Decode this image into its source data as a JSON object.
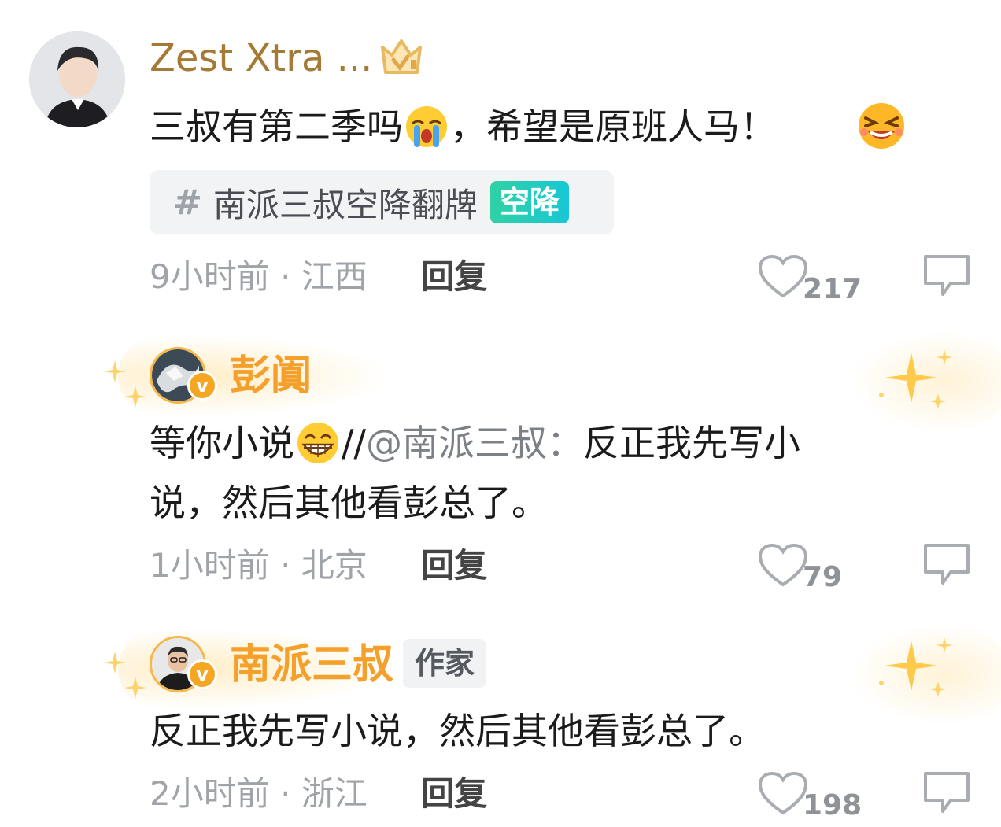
{
  "comments": [
    {
      "username": "Zest Xtra ...",
      "text_before_emoji": "三叔有第二季吗",
      "text_after_emoji": "，希望是原班人马！",
      "topic": {
        "hash": "#",
        "label": "南派三叔空降翻牌",
        "tag": "空降"
      },
      "meta": "9小时前 · 江西",
      "reply_label": "回复",
      "likes": "217"
    },
    {
      "username": "彭阗",
      "text_before_emoji": "等你小说",
      "text_after_emoji_prefix": "//",
      "mention": "@南派三叔：",
      "text_line1_rest": "反正我先写小",
      "text_line2": "说，然后其他看彭总了。",
      "meta": "1小时前 · 北京",
      "reply_label": "回复",
      "likes": "79"
    },
    {
      "username": "南派三叔",
      "role": "作家",
      "text": "反正我先写小说，然后其他看彭总了。",
      "meta": "2小时前 · 浙江",
      "reply_label": "回复",
      "likes": "198"
    }
  ],
  "verified_badge": "v",
  "colors": {
    "username_gold": "#a57a34",
    "vip_orange": "#f5a02a",
    "topic_tag_green": "#30d1a4",
    "meta_gray": "#a0a4a9"
  }
}
